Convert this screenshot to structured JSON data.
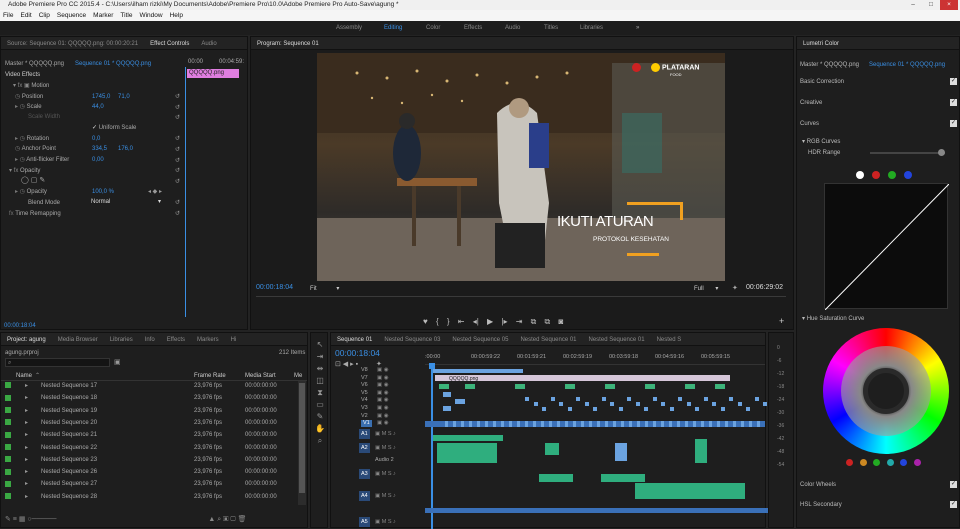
{
  "window": {
    "title": "Adobe Premiere Pro CC 2015.4 - C:\\Users\\ilham rizki\\My Documents\\Adobe\\Premiere Pro\\10.0\\Adobe Premiere Pro Auto-Save\\agung *"
  },
  "menu": [
    "File",
    "Edit",
    "Clip",
    "Sequence",
    "Marker",
    "Title",
    "Window",
    "Help"
  ],
  "workspaces": [
    "Assembly",
    "Editing",
    "Color",
    "Effects",
    "Audio",
    "Titles",
    "Libraries"
  ],
  "workspace_active": "Editing",
  "effect_panel": {
    "tabs": [
      "Source: Sequence 01: QQQQQ.png: 00:00:20:21",
      "Effect Controls",
      "Audio"
    ],
    "master": "Master * QQQQQ.png",
    "sequence": "Sequence 01 * QQQQQ.png",
    "time_start": "00:00",
    "time_end": "00:04:59:",
    "clip_label": "QQQQQ.png",
    "video_effects": "Video Effects",
    "motion": "Motion",
    "position_label": "Position",
    "position_x": "1745,0",
    "position_y": "71,0",
    "scale_label": "Scale",
    "scale_value": "44,0",
    "scale_width_label": "Scale Width",
    "uniform_scale": "Uniform Scale",
    "rotation_label": "Rotation",
    "rotation_value": "0,0",
    "anchor_label": "Anchor Point",
    "anchor_x": "334,5",
    "anchor_y": "176,0",
    "flicker_label": "Anti-flicker Filter",
    "flicker_value": "0,00",
    "opacity_section": "Opacity",
    "opacity_label": "Opacity",
    "opacity_value": "100,0 %",
    "blend_label": "Blend Mode",
    "blend_value": "Normal",
    "time_remap": "Time Remapping",
    "timecode": "00:00:18:04"
  },
  "program": {
    "tab": "Program: Sequence 01",
    "overlay_title": "IKUTI ATURAN",
    "overlay_sub": "PROTOKOL KESEHATAN",
    "brand": "PLATARAN",
    "brand_sub": "FOOD",
    "timecode": "00:00:18:04",
    "fit": "Fit",
    "full": "Full",
    "duration": "00:06:29:02"
  },
  "project": {
    "tabs": [
      "Project: agung",
      "Media Browser",
      "Libraries",
      "Info",
      "Effects",
      "Markers",
      "Hi"
    ],
    "file": "agung.prproj",
    "count": "212 Items",
    "columns": [
      "Name",
      "Frame Rate",
      "Media Start",
      "Me"
    ],
    "items": [
      {
        "name": "Nested Sequence 17",
        "rate": "23,976 fps",
        "start": "00:00:00:00"
      },
      {
        "name": "Nested Sequence 18",
        "rate": "23,976 fps",
        "start": "00:00:00:00"
      },
      {
        "name": "Nested Sequence 19",
        "rate": "23,976 fps",
        "start": "00:00:00:00"
      },
      {
        "name": "Nested Sequence 20",
        "rate": "23,976 fps",
        "start": "00:00:00:00"
      },
      {
        "name": "Nested Sequence 21",
        "rate": "23,976 fps",
        "start": "00:00:00:00"
      },
      {
        "name": "Nested Sequence 22",
        "rate": "23,976 fps",
        "start": "00:00:00:00"
      },
      {
        "name": "Nested Sequence 23",
        "rate": "23,976 fps",
        "start": "00:00:00:00"
      },
      {
        "name": "Nested Sequence 26",
        "rate": "23,976 fps",
        "start": "00:00:00:00"
      },
      {
        "name": "Nested Sequence 27",
        "rate": "23,976 fps",
        "start": "00:00:00:00"
      },
      {
        "name": "Nested Sequence 28",
        "rate": "23,976 fps",
        "start": "00:00:00:00"
      }
    ]
  },
  "timeline": {
    "tabs": [
      "Sequence 01",
      "Nested Sequence 03",
      "Nested Sequence 05",
      "Nested Sequence 01",
      "Nested Sequence 01",
      "Nested S"
    ],
    "timecode": "00:00:18:04",
    "ruler": [
      ":00:00",
      "00:00:59:22",
      "00:01:59:21",
      "00:02:59:19",
      "00:03:59:18",
      "00:04:59:16",
      "00:05:59:15"
    ],
    "video_tracks": [
      "V8",
      "V7",
      "V6",
      "V5",
      "V4",
      "V3",
      "V2",
      "V1"
    ],
    "audio_tracks": [
      "A1",
      "A2",
      "A3",
      "A4",
      "A5"
    ],
    "clip_label": "QQQQQ.png",
    "audio2_label": "Audio 2",
    "db_scale": [
      "0",
      "-6",
      "-12",
      "-18",
      "-24",
      "-30",
      "-36",
      "-42",
      "-48",
      "-54"
    ]
  },
  "lumetri": {
    "tab": "Lumetri Color",
    "master": "Master * QQQQQ.png",
    "sequence": "Sequence 01 * QQQQQ.png",
    "sections": [
      "Basic Correction",
      "Creative",
      "Curves"
    ],
    "rgb_curves": "RGB Curves",
    "hdr_range": "HDR Range",
    "hue_sat": "Hue Saturation Curve",
    "color_wheels": "Color Wheels",
    "hsl": "HSL Secondary",
    "dot_colors": [
      "#ffffff",
      "#cc2222",
      "#22aa22",
      "#2244dd"
    ],
    "wheel_dots": [
      "#cc2222",
      "#cc8822",
      "#22aa22",
      "#22aaaa",
      "#2244dd",
      "#aa22aa"
    ]
  }
}
